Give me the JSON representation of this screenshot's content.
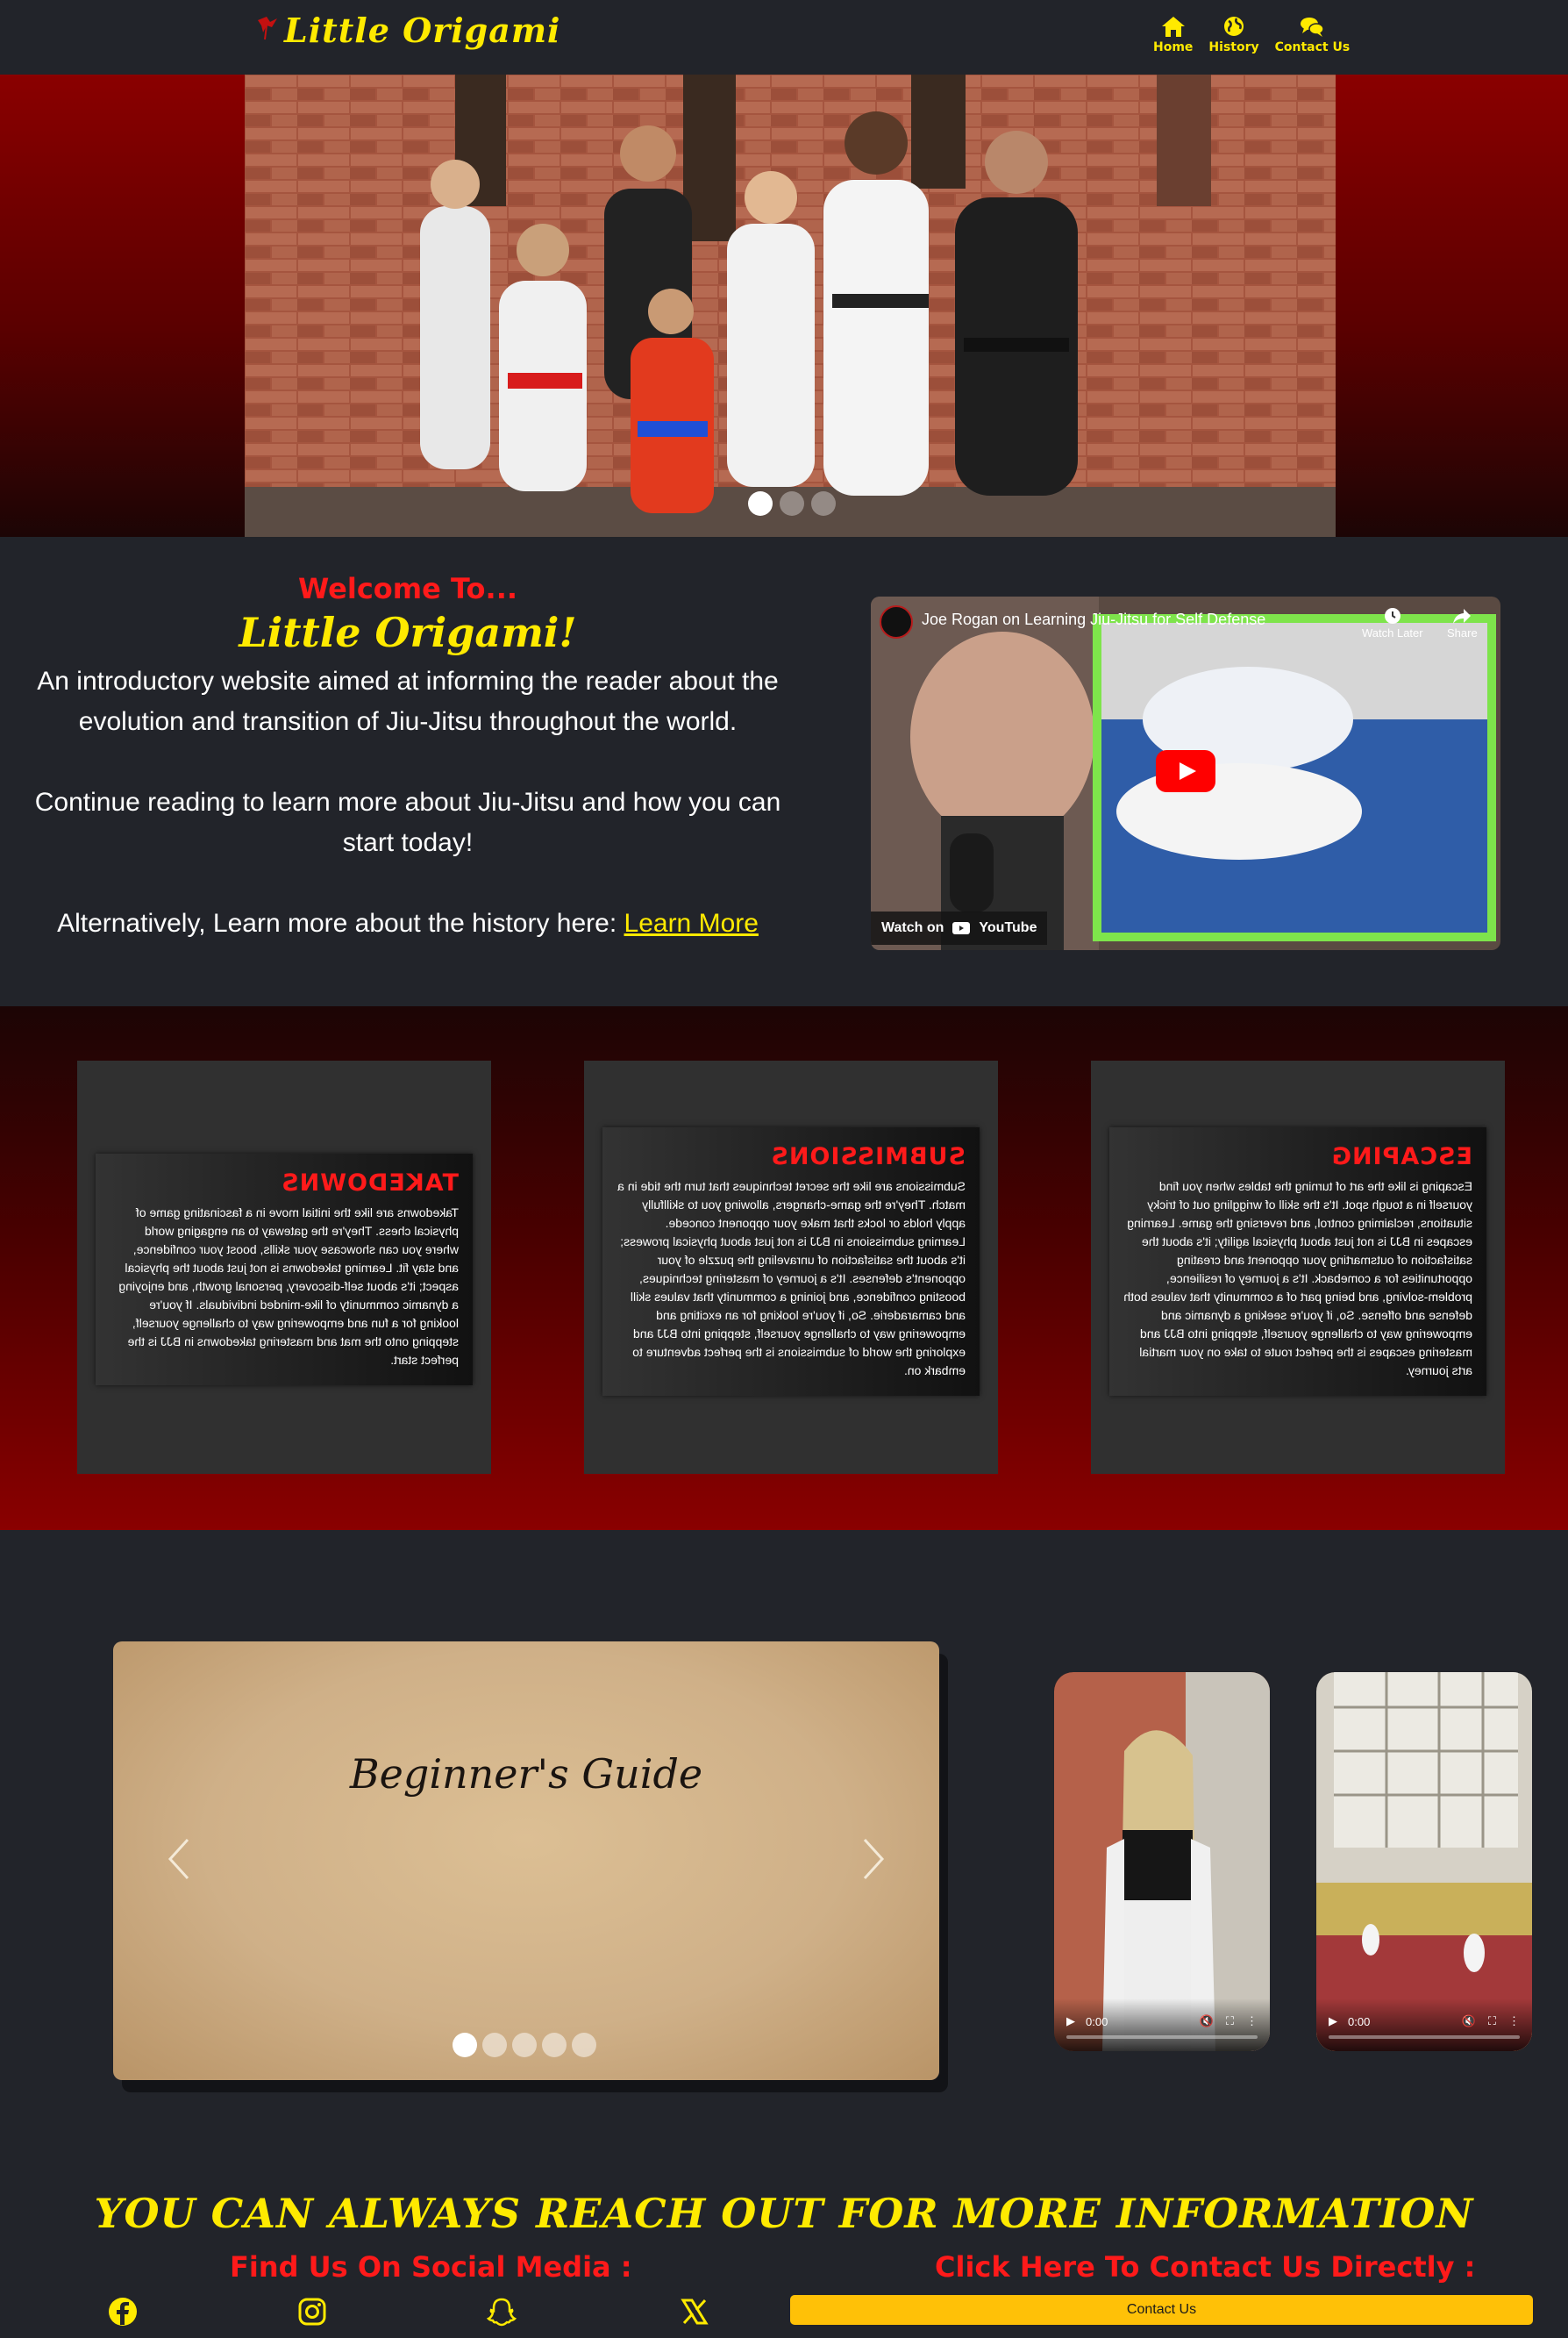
{
  "brand": {
    "name": "Little Origami"
  },
  "nav": [
    {
      "label": "Home",
      "icon": "home-icon"
    },
    {
      "label": "History",
      "icon": "globe-icon"
    },
    {
      "label": "Contact Us",
      "icon": "chat-icon"
    }
  ],
  "hero": {
    "slides": 3,
    "active_slide": 1
  },
  "intro": {
    "welcome": "Welcome To...",
    "title": "Little Origami!",
    "p1": "An introductory website aimed at informing the reader about the evolution and transition of Jiu-Jitsu throughout the world.",
    "p2": "Continue reading to learn more about Jiu-Jitsu and how you can start today!",
    "p3_prefix": "Alternatively, Learn more about the history here: ",
    "p3_link": "Learn More"
  },
  "video": {
    "title": "Joe Rogan on Learning Jiu-Jitsu for Self Defense",
    "watch_later": "Watch Later",
    "share": "Share",
    "watch_on": "Watch on",
    "youtube": "YouTube"
  },
  "cards": [
    {
      "title": "TAKEDOWNS",
      "body": "Takedowns are like the initial move in a fascinating game of physical chess. They're the gateway to an engaging world where you can showcase your skills, boost your confidence, and stay fit. Learning takedowns is not just about the physical aspect; it's about self-discovery, personal growth, and enjoying a dynamic community of like-minded individuals. If you're looking for a fun and empowering way to challenge yourself, stepping onto the mat and mastering takedowns in BJJ is the perfect start."
    },
    {
      "title": "SUBMISSIONS",
      "body": "Submissions are like the secret techniques that turn the tide in a match. They're the game-changers, allowing you to skillfully apply holds or locks that make your opponent concede. Learning submissions in BJJ is not just about physical prowess; it's about the satisfaction of unraveling the puzzle of your opponent's defenses. It's a journey of mastering techniques, boosting confidence, and joining a community that values skill and camaraderie. So, if you're looking for an exciting and empowering way to challenge yourself, stepping into BJJ and exploring the world of submissions is the perfect adventure to embark on."
    },
    {
      "title": "ESCAPING",
      "body": "Escaping is like the art of turning the tables when you find yourself in a tough spot. It's the skill of wriggling out of tricky situations, reclaiming control, and reversing the game. Learning escapes in BJJ is not just about physical agility; it's about the satisfaction of outsmarting your opponent and creating opportunities for a comeback. It's a journey of resilience, problem-solving, and being part of a community that values both defense and offense. So, if you're seeking a dynamic and empowering way to challenge yourself, stepping into BJJ and mastering escapes is the perfect route to take on your martial arts journey."
    }
  ],
  "guide": {
    "title": "Beginner's Guide",
    "slides": 5,
    "active_slide": 1
  },
  "videos": [
    {
      "time": "0:00"
    },
    {
      "time": "0:00"
    }
  ],
  "footer": {
    "reach": "YOU CAN ALWAYS REACH OUT FOR MORE INFORMATION",
    "social_heading": "Find Us On Social Media :",
    "contact_heading": "Click Here To Contact Us Directly :",
    "contact_button": "Contact Us",
    "socials": [
      "facebook-icon",
      "instagram-icon",
      "snapchat-icon",
      "x-icon"
    ]
  },
  "colors": {
    "accent_yellow": "#ffea00",
    "accent_red": "#ff1a1a",
    "background": "#22242a",
    "button": "#ffc107"
  }
}
